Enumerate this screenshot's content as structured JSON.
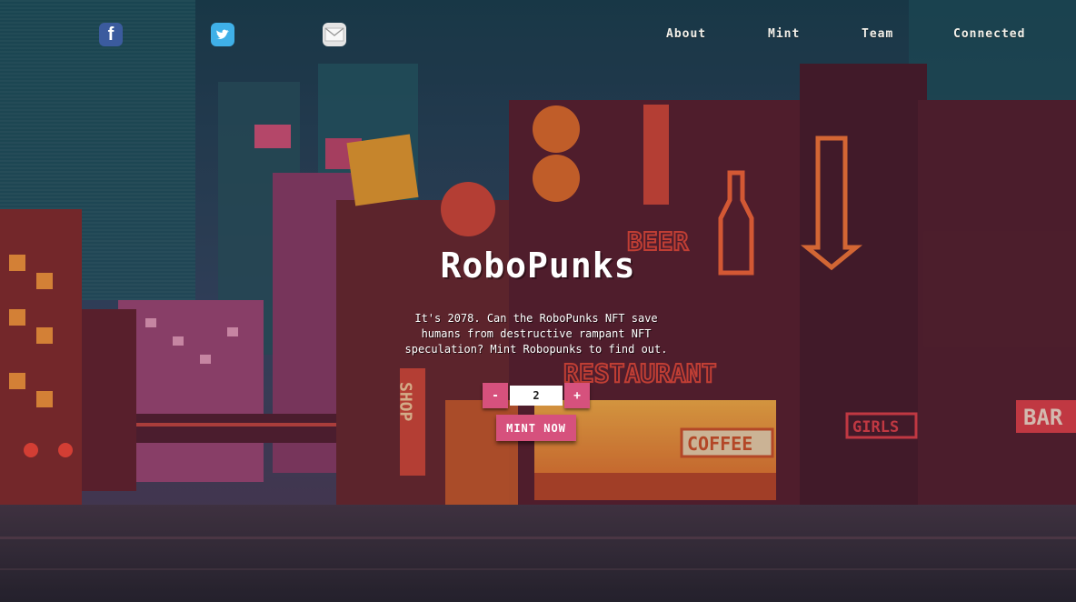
{
  "nav": {
    "about_label": "About",
    "mint_label": "Mint",
    "team_label": "Team",
    "connected_label": "Connected"
  },
  "social": {
    "facebook_icon": "facebook-icon",
    "twitter_icon": "twitter-icon",
    "email_icon": "email-icon"
  },
  "hero": {
    "title": "RoboPunks",
    "description": "It's 2078. Can the RoboPunks NFT save humans from destructive rampant NFT speculation? Mint Robopunks to find out."
  },
  "mint": {
    "decrement_label": "-",
    "quantity": "2",
    "increment_label": "+",
    "mint_button_label": "MINT NOW"
  },
  "signs": {
    "beer": "BEER",
    "restaurant": "RESTAURANT",
    "shop": "SHOP",
    "coffee": "COFFEE",
    "girls": "GIRLS",
    "bar": "BAR"
  },
  "colors": {
    "accent": "#d6517d",
    "sky": "#1f4a5a",
    "neon_orange": "#ff7a2e",
    "neon_red": "#e8424b"
  }
}
